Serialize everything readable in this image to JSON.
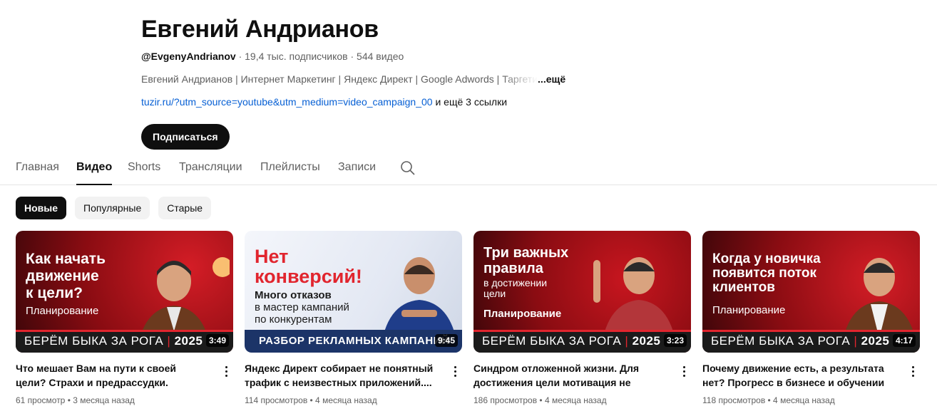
{
  "channel": {
    "name": "Евгений Андрианов",
    "handle": "@EvgenyAndrianov",
    "meta_rest": " · 19,4 тыс. подписчиков · 544 видео",
    "description_main": "Евгений Андрианов | Интернет Маркетинг | Яндекс Директ | Google Adwords | ",
    "description_fade": "Таргети",
    "description_more": "...ещё",
    "link_text": "tuzir.ru/?utm_source=youtube&utm_medium=video_campaign_00",
    "link_rest": " и ещё 3 ссылки",
    "subscribe_label": "Подписаться"
  },
  "tabs": [
    {
      "label": "Главная"
    },
    {
      "label": "Видео"
    },
    {
      "label": "Shorts"
    },
    {
      "label": "Трансляции"
    },
    {
      "label": "Плейлисты"
    },
    {
      "label": "Записи"
    }
  ],
  "search_icon": "search-icon",
  "chips": [
    {
      "label": "Новые"
    },
    {
      "label": "Популярные"
    },
    {
      "label": "Старые"
    }
  ],
  "videos": [
    {
      "thumb_lines": [
        "Как начать",
        "движение",
        "к цели?"
      ],
      "thumb_sub": "Планирование",
      "thumb_bar": "БЕРЁМ БЫКА ЗА РОГА",
      "thumb_year": "2025",
      "duration": "3:49",
      "title": "Что мешает Вам на пути к своей цели? Страхи и предрассудки. Скорость и...",
      "meta": "61 просмотр • 3 месяца назад"
    },
    {
      "thumb_lines": [
        "Нет",
        "конверсий!"
      ],
      "thumb_sub_lines": [
        "Много отказов",
        "в мастер кампаний",
        "по конкурентам"
      ],
      "thumb_bar": "РАЗБОР РЕКЛАМНЫХ КАМПАНИЙ",
      "duration": "9:45",
      "title": "Яндекс Директ собирает не понятный трафик с неизвестных приложений....",
      "meta": "114 просмотров • 4 месяца назад"
    },
    {
      "thumb_lines": [
        "Три важных",
        "правила"
      ],
      "thumb_sub_lines": [
        "в достижении",
        "цели"
      ],
      "thumb_sub": "Планирование",
      "thumb_bar": "БЕРЁМ БЫКА ЗА РОГА",
      "thumb_year": "2025",
      "duration": "3:23",
      "title": "Синдром отложенной жизни. Для достижения цели мотивация не нужна,...",
      "meta": "186 просмотров • 4 месяца назад"
    },
    {
      "thumb_lines": [
        "Когда у новичка",
        "появится поток",
        "клиентов"
      ],
      "thumb_sub": "Планирование",
      "thumb_bar": "БЕРЁМ БЫКА ЗА РОГА",
      "thumb_year": "2025",
      "duration": "4:17",
      "title": "Почему движение есть, а результата нет? Прогресс в бизнесе и обучении всегда...",
      "meta": "118 просмотров • 4 месяца назад"
    }
  ],
  "colors": {
    "thumb_red": "#b5121b",
    "thumb_dark": "#3a0609",
    "bar_dark": "#1b1b1b",
    "link_blue": "#065fd4"
  }
}
